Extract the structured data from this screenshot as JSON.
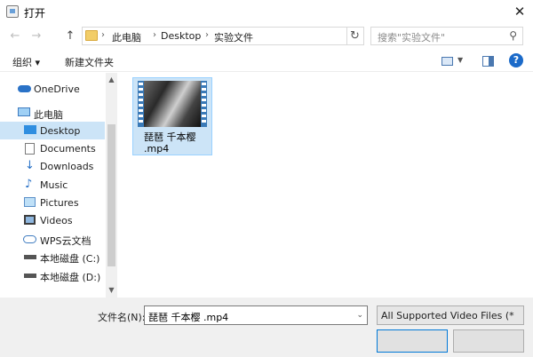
{
  "window": {
    "title": "打开",
    "close_glyph": "✕"
  },
  "nav": {
    "back_glyph": "←",
    "forward_glyph": "→",
    "up_glyph": "↑"
  },
  "address": {
    "crumbs": [
      "此电脑",
      "Desktop",
      "实验文件"
    ],
    "separator": "›",
    "dropdown_glyph": "⌄",
    "refresh_glyph": "↻"
  },
  "search": {
    "placeholder": "搜索\"实验文件\"",
    "icon_glyph": "⚲"
  },
  "toolbar": {
    "organize_label": "组织 ▾",
    "new_folder_label": "新建文件夹",
    "view_dd_glyph": "▼",
    "help_glyph": "?"
  },
  "sidebar": {
    "items": [
      {
        "label": "OneDrive",
        "icon": "onedrive-icon"
      },
      {
        "label": "此电脑",
        "icon": "computer-icon"
      },
      {
        "label": "Desktop",
        "icon": "desktop-icon",
        "selected": true
      },
      {
        "label": "Documents",
        "icon": "documents-icon"
      },
      {
        "label": "Downloads",
        "icon": "downloads-icon"
      },
      {
        "label": "Music",
        "icon": "music-icon"
      },
      {
        "label": "Pictures",
        "icon": "pictures-icon"
      },
      {
        "label": "Videos",
        "icon": "videos-icon"
      },
      {
        "label": "WPS云文档",
        "icon": "cloud-icon"
      },
      {
        "label": "本地磁盘 (C:)",
        "icon": "drive-icon"
      },
      {
        "label": "本地磁盘 (D:)",
        "icon": "drive-icon"
      }
    ],
    "scroll_up_glyph": "▲",
    "scroll_down_glyph": "▼"
  },
  "files": [
    {
      "name_line1": "琵琶 千本樱",
      "name_line2": ".mp4",
      "icon": "video-file-icon"
    }
  ],
  "footer": {
    "filename_label": "文件名(N):",
    "filename_value": "琵琶 千本樱 .mp4",
    "dropdown_glyph": "⌄",
    "filetype_value": "All Supported Video Files (*",
    "open_label": "",
    "cancel_label": ""
  },
  "colors": {
    "accent": "#0078d7",
    "selection": "#cce4f7",
    "help": "#1b6ac9"
  }
}
